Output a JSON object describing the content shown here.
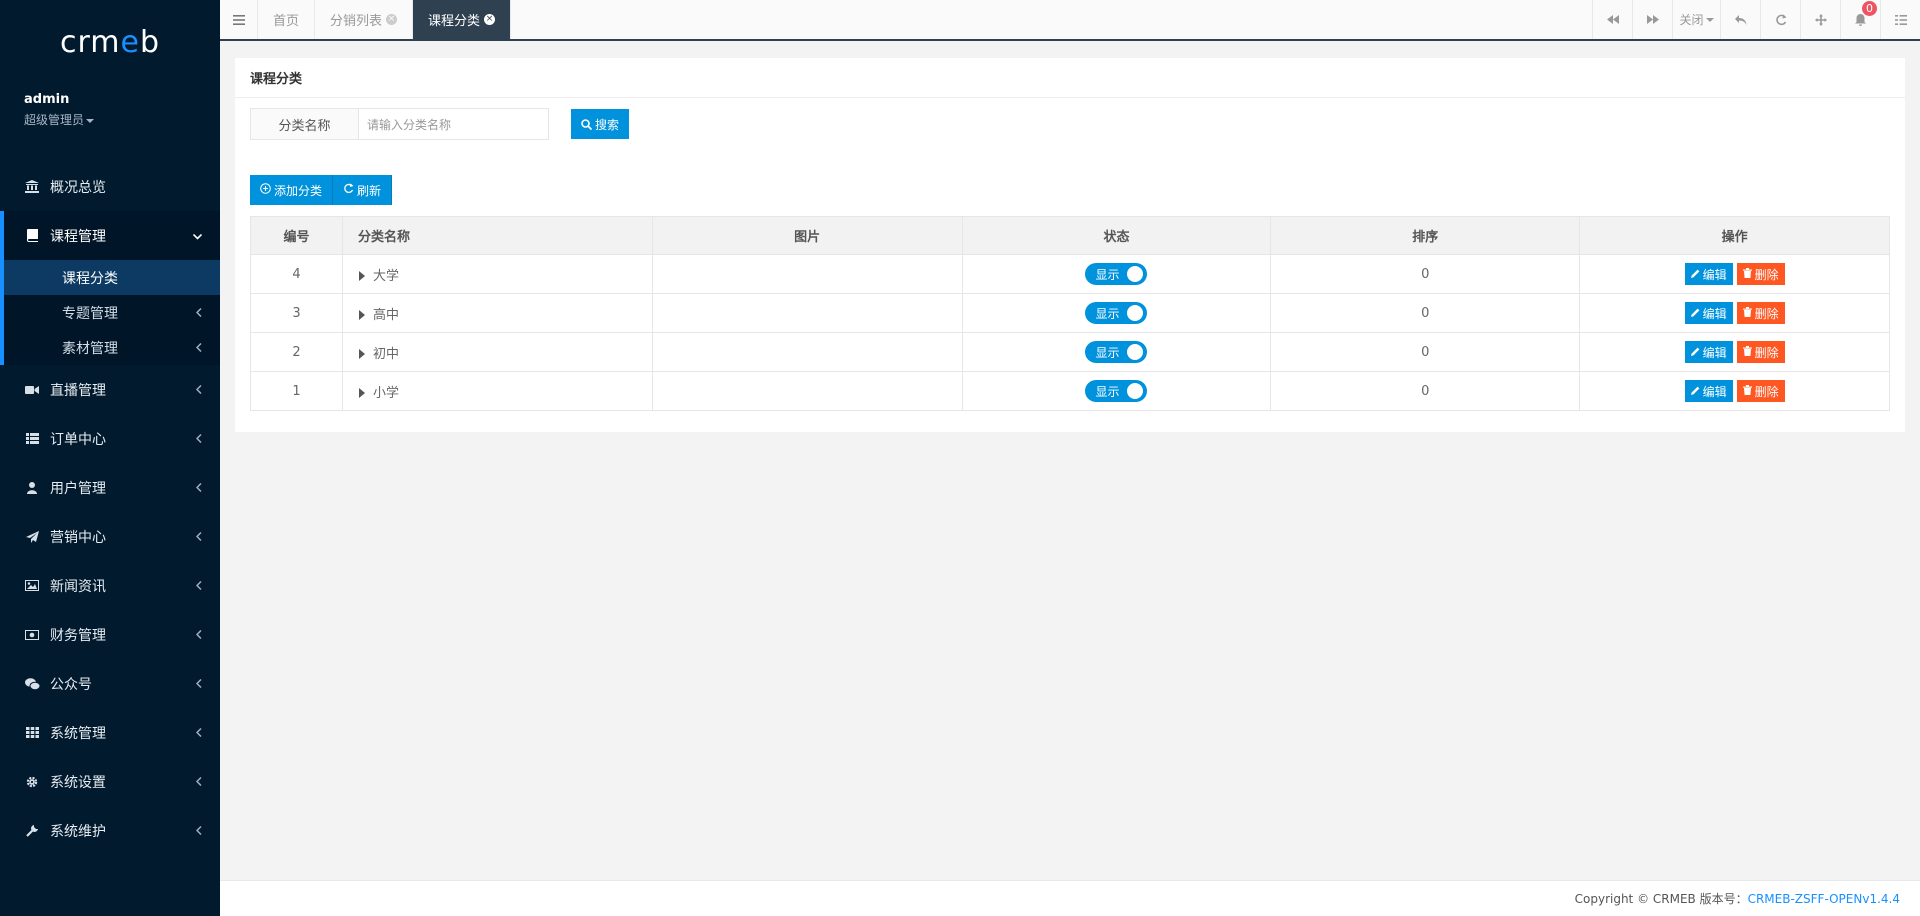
{
  "logo": {
    "text_pre": "crm",
    "text_e": "e",
    "text_post": "b"
  },
  "user": {
    "name": "admin",
    "role": "超级管理员"
  },
  "sidebar": {
    "items": [
      {
        "label": "概况总览",
        "icon": "bank-icon"
      },
      {
        "label": "课程管理",
        "icon": "book-icon"
      },
      {
        "label": "直播管理",
        "icon": "video-icon"
      },
      {
        "label": "订单中心",
        "icon": "list-icon"
      },
      {
        "label": "用户管理",
        "icon": "user-icon"
      },
      {
        "label": "营销中心",
        "icon": "paper-plane-icon"
      },
      {
        "label": "新闻资讯",
        "icon": "image-icon"
      },
      {
        "label": "财务管理",
        "icon": "money-icon"
      },
      {
        "label": "公众号",
        "icon": "wechat-icon"
      },
      {
        "label": "系统管理",
        "icon": "grid-icon"
      },
      {
        "label": "系统设置",
        "icon": "gear-icon"
      },
      {
        "label": "系统维护",
        "icon": "wrench-icon"
      }
    ],
    "sub_items": [
      {
        "label": "课程分类"
      },
      {
        "label": "专题管理"
      },
      {
        "label": "素材管理"
      }
    ]
  },
  "tabs": [
    {
      "label": "首页"
    },
    {
      "label": "分销列表"
    },
    {
      "label": "课程分类"
    }
  ],
  "topbar": {
    "close_label": "关闭",
    "notification_count": "0"
  },
  "panel": {
    "title": "课程分类"
  },
  "filter": {
    "label": "分类名称",
    "placeholder": "请输入分类名称",
    "search_label": "搜索"
  },
  "toolbar": {
    "add_label": "添加分类",
    "refresh_label": "刷新"
  },
  "table": {
    "headers": [
      "编号",
      "分类名称",
      "图片",
      "状态",
      "排序",
      "操作"
    ],
    "rows": [
      {
        "id": "4",
        "name": "大学",
        "status": "显示",
        "sort": "0"
      },
      {
        "id": "3",
        "name": "高中",
        "status": "显示",
        "sort": "0"
      },
      {
        "id": "2",
        "name": "初中",
        "status": "显示",
        "sort": "0"
      },
      {
        "id": "1",
        "name": "小学",
        "status": "显示",
        "sort": "0"
      }
    ],
    "edit_label": "编辑",
    "delete_label": "删除"
  },
  "footer": {
    "copyright": "Copyright © CRMEB 版本号：",
    "version": "CRMEB-ZSFF-OPENv1.4.4"
  },
  "colors": {
    "primary": "#0092dc",
    "danger": "#ff5722",
    "sidebar_bg": "#021a2e",
    "active_tab": "#2f4050"
  }
}
